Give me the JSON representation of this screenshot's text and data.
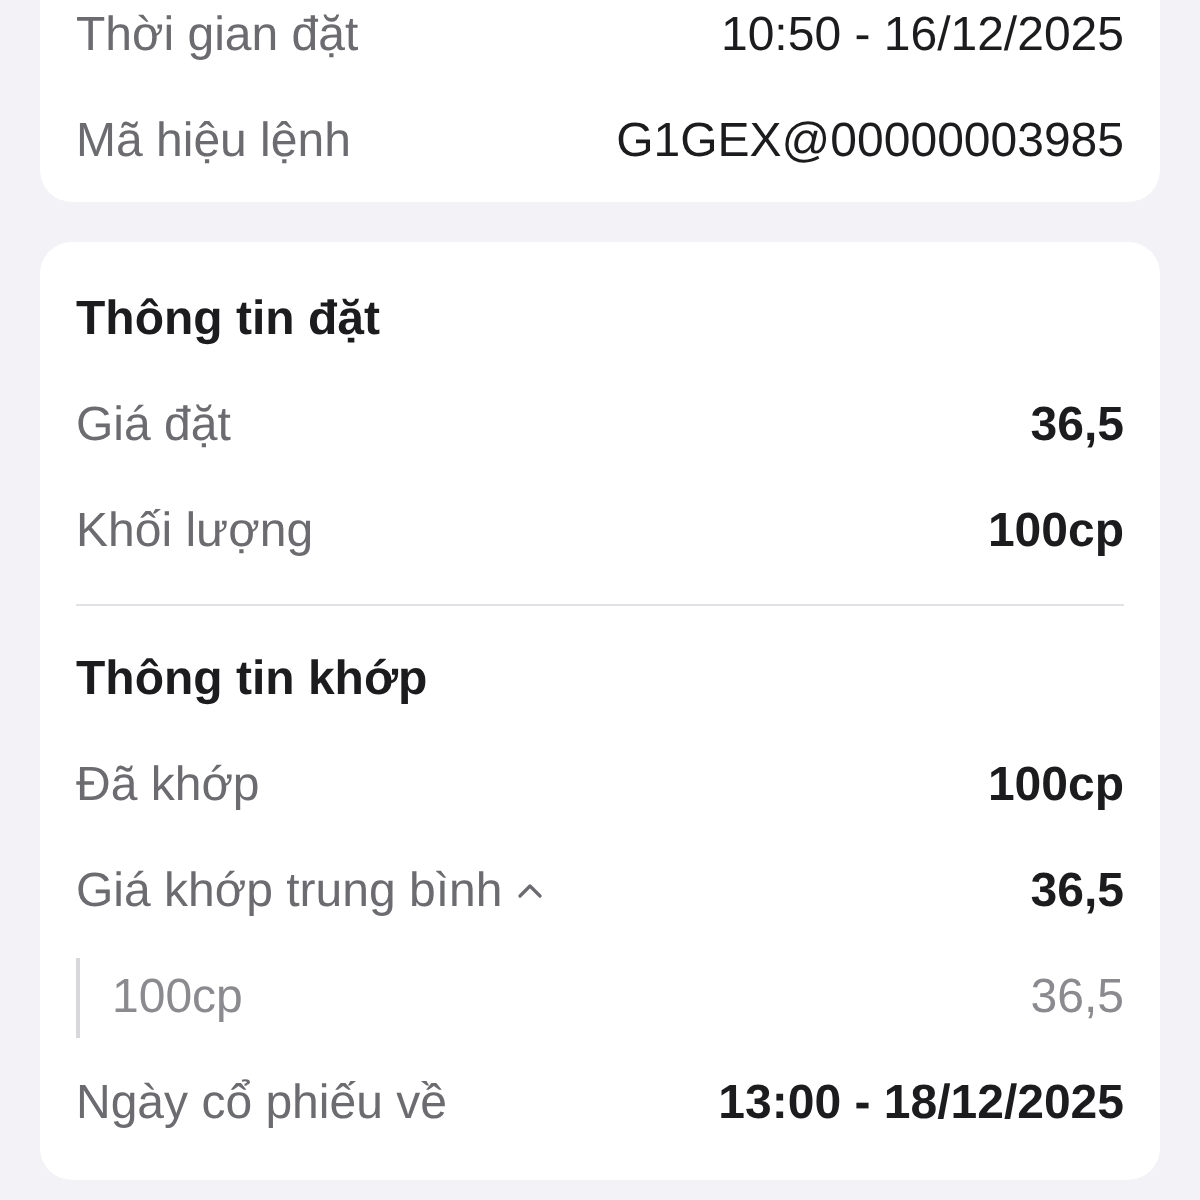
{
  "order_info": [
    {
      "label": "Thời gian đặt",
      "value": "10:50 - 16/12/2025"
    },
    {
      "label": "Mã hiệu lệnh",
      "value": "G1GEX@00000003985"
    }
  ],
  "sections": [
    {
      "title": "Thông tin đặt",
      "rows": [
        {
          "kind": "plain",
          "label": "Giá đặt",
          "value": "36,5"
        },
        {
          "kind": "plain",
          "label": "Khối lượng",
          "value": "100cp"
        }
      ]
    },
    {
      "title": "Thông tin khớp",
      "rows": [
        {
          "kind": "plain",
          "label": "Đã khớp",
          "value": "100cp"
        },
        {
          "kind": "expandable",
          "label": "Giá khớp trung bình",
          "value": "36,5",
          "expanded": true,
          "children": [
            {
              "label": "100cp",
              "value": "36,5"
            }
          ]
        },
        {
          "kind": "plain",
          "label": "Ngày cổ phiếu về",
          "value": "13:00 - 18/12/2025"
        }
      ]
    }
  ]
}
